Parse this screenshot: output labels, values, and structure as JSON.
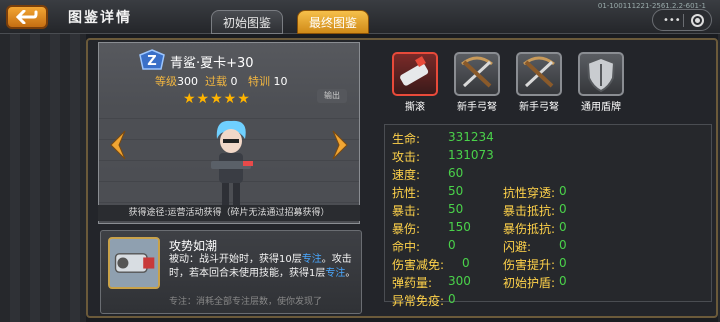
{
  "header": {
    "title": "图鉴详情",
    "tabs": [
      "初始图鉴",
      "最终图鉴"
    ],
    "id_text": "01-100111221-2561.2.2-601-1"
  },
  "hero": {
    "name": "青鲨·夏卡+30",
    "level_label": "等级",
    "level": "300",
    "break_label": "过载",
    "break": "0",
    "train_label": "特训",
    "train": "10",
    "stars": "★★★★★",
    "exit": "输出",
    "obtain": "获得途径:运营活动获得（碎片无法通过招募获得）"
  },
  "skill": {
    "title": "攻势如潮",
    "desc_a": "被动：战斗开始时，获得10层",
    "desc_hl1": "专注",
    "desc_b": "。攻击时，若本回合未使用技能，获得1层",
    "desc_hl2": "专注",
    "desc_c": "。",
    "desc_more": "专注：消耗全部专注层数，使你发现了"
  },
  "equipment": [
    {
      "label": "撕滚",
      "icon": "cannon-icon",
      "selected": true
    },
    {
      "label": "新手弓弩",
      "icon": "crossbow-icon",
      "selected": false
    },
    {
      "label": "新手弓弩",
      "icon": "crossbow-icon",
      "selected": false
    },
    {
      "label": "通用盾牌",
      "icon": "shield-icon",
      "selected": false
    }
  ],
  "stats": [
    {
      "label": "生命:",
      "value": "331234"
    },
    {
      "label": "攻击:",
      "value": "131073"
    },
    {
      "label": "速度:",
      "value": "60"
    },
    {
      "label": "抗性:",
      "value": "50"
    },
    {
      "label": "抗性穿透:",
      "value": "0"
    },
    {
      "label": "暴击:",
      "value": "50"
    },
    {
      "label": "暴击抵抗:",
      "value": "0"
    },
    {
      "label": "暴伤:",
      "value": "150"
    },
    {
      "label": "暴伤抵抗:",
      "value": "0"
    },
    {
      "label": "命中:",
      "value": "0"
    },
    {
      "label": "闪避:",
      "value": "0"
    },
    {
      "label": "伤害减免:",
      "value": "0"
    },
    {
      "label": "伤害提升:",
      "value": "0"
    },
    {
      "label": "弹药量:",
      "value": "300"
    },
    {
      "label": "初始护盾:",
      "value": "0"
    },
    {
      "label": "异常免疫:",
      "value": "0"
    }
  ],
  "colors": {
    "label": "#ffd24a",
    "value": "#4ad24a",
    "accent": "#f0a030"
  }
}
